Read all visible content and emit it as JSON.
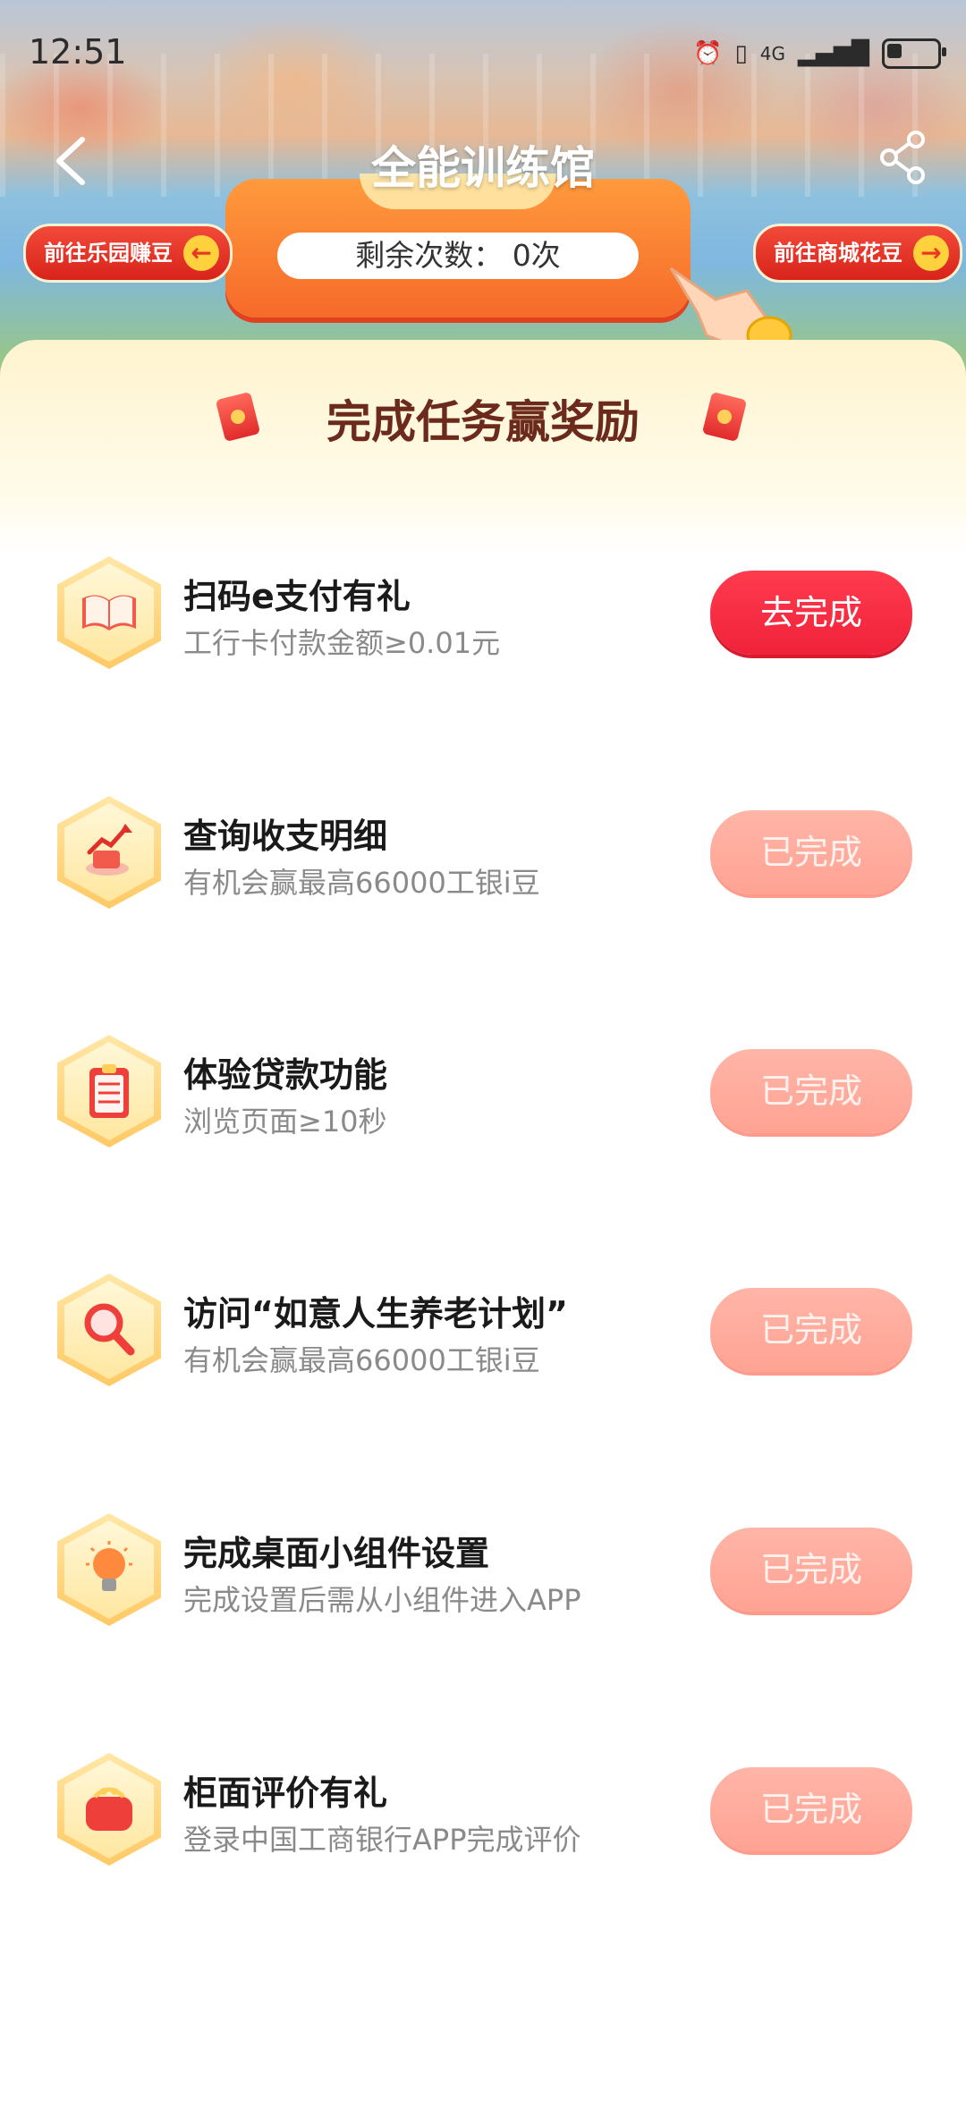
{
  "statusbar": {
    "time": "12:51",
    "network": "4G"
  },
  "nav": {
    "title": "全能训练馆"
  },
  "banner": {
    "left_button": "前往乐园赚豆",
    "right_button": "前往商城花豆",
    "remain_label": "剩余次数：",
    "remain_value": "0次"
  },
  "tasks_section": {
    "title": "完成任务赢奖励",
    "items": [
      {
        "title": "扫码e支付有礼",
        "subtitle": "工行卡付款金额≥0.01元",
        "button": "去完成",
        "status": "todo",
        "icon": "book-icon"
      },
      {
        "title": "查询收支明细",
        "subtitle": "有机会赢最高66000工银i豆",
        "button": "已完成",
        "status": "done",
        "icon": "chart-icon"
      },
      {
        "title": "体验贷款功能",
        "subtitle": "浏览页面≥10秒",
        "button": "已完成",
        "status": "done",
        "icon": "clipboard-icon"
      },
      {
        "title": "访问“如意人生养老计划”",
        "subtitle": "有机会赢最高66000工银i豆",
        "button": "已完成",
        "status": "done",
        "icon": "magnifier-icon"
      },
      {
        "title": "完成桌面小组件设置",
        "subtitle": "完成设置后需从小组件进入APP",
        "button": "已完成",
        "status": "done",
        "icon": "lightbulb-icon"
      },
      {
        "title": "柜面评价有礼",
        "subtitle": "登录中国工商银行APP完成评价",
        "button": "已完成",
        "status": "done",
        "icon": "wallet-icon"
      }
    ]
  },
  "colors": {
    "primary_red": "#f0223a",
    "done_pink": "#ffa99a",
    "title_brown": "#6b2a1b"
  }
}
